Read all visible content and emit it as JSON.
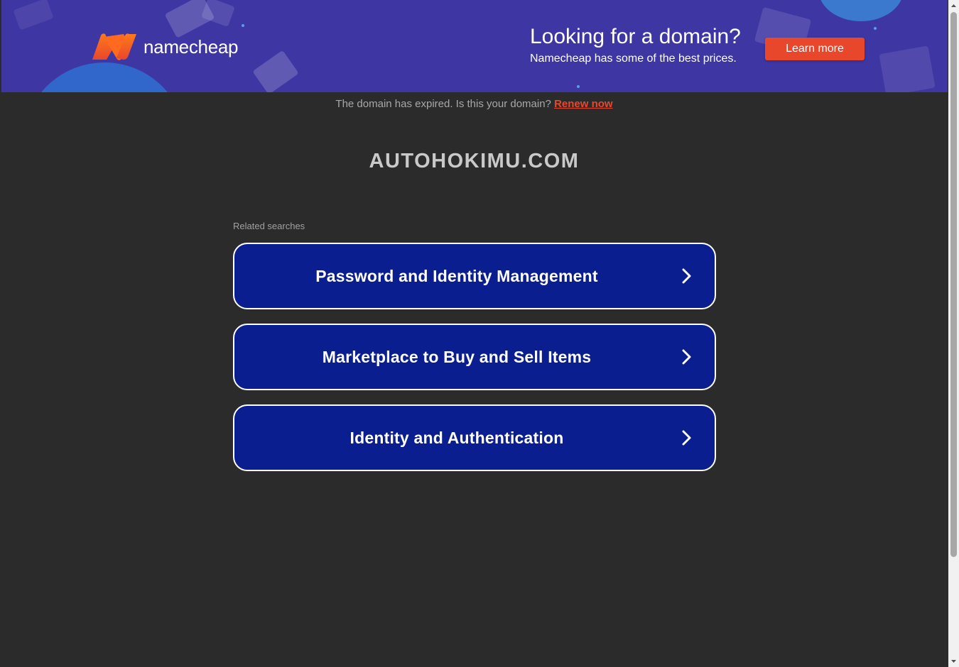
{
  "banner": {
    "logo_text": "namecheap",
    "promo_title": "Looking for a domain?",
    "promo_subtitle": "Namecheap has some of the best prices.",
    "cta_label": "Learn more",
    "colors": {
      "background": "#3e36a3",
      "cta": "#e8472c",
      "logo_orange": "#ff6a1f"
    }
  },
  "notice": {
    "text": "The domain has expired. Is this your domain?",
    "link_label": "Renew now"
  },
  "domain_name": "AUTOHOKIMU.COM",
  "related": {
    "label": "Related searches",
    "items": [
      {
        "label": "Password and Identity Management",
        "icon": "chevron-right-icon"
      },
      {
        "label": "Marketplace to Buy and Sell Items",
        "icon": "chevron-right-icon"
      },
      {
        "label": "Identity and Authentication",
        "icon": "chevron-right-icon"
      }
    ],
    "button_color": "#0a1e8f"
  }
}
